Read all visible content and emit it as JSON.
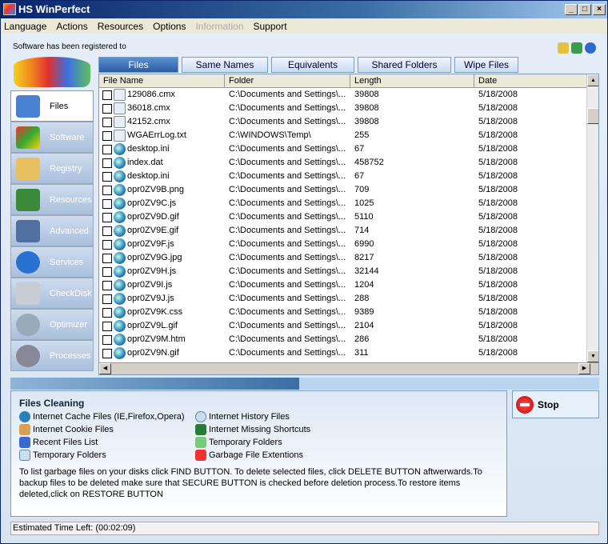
{
  "window": {
    "title": "HS WinPerfect"
  },
  "menu": [
    "Language",
    "Actions",
    "Resources",
    "Options",
    "Information",
    "Support"
  ],
  "registered": "Software has been registered to",
  "sidebar": [
    "Files",
    "Software",
    "Registry",
    "Resources",
    "Advanced",
    "Services",
    "CheckDisk",
    "Optimizer",
    "Processes"
  ],
  "tabs": [
    "Files",
    "Same Names",
    "Equivalents",
    "Shared Folders",
    "Wipe Files"
  ],
  "columns": [
    "File Name",
    "Folder",
    "Length",
    "Date"
  ],
  "rows": [
    [
      "129086.cmx",
      "C:\\Documents and Settings\\...",
      "39808",
      "5/18/2008",
      "doc"
    ],
    [
      "36018.cmx",
      "C:\\Documents and Settings\\...",
      "39808",
      "5/18/2008",
      "doc"
    ],
    [
      "42152.cmx",
      "C:\\Documents and Settings\\...",
      "39808",
      "5/18/2008",
      "doc"
    ],
    [
      "WGAErrLog.txt",
      "C:\\WINDOWS\\Temp\\",
      "255",
      "5/18/2008",
      "doc"
    ],
    [
      "desktop.ini",
      "C:\\Documents and Settings\\...",
      "67",
      "5/18/2008",
      "globe"
    ],
    [
      "index.dat",
      "C:\\Documents and Settings\\...",
      "458752",
      "5/18/2008",
      "globe"
    ],
    [
      "desktop.ini",
      "C:\\Documents and Settings\\...",
      "67",
      "5/18/2008",
      "globe"
    ],
    [
      "opr0ZV9B.png",
      "C:\\Documents and Settings\\...",
      "709",
      "5/18/2008",
      "globe"
    ],
    [
      "opr0ZV9C.js",
      "C:\\Documents and Settings\\...",
      "1025",
      "5/18/2008",
      "globe"
    ],
    [
      "opr0ZV9D.gif",
      "C:\\Documents and Settings\\...",
      "5110",
      "5/18/2008",
      "globe"
    ],
    [
      "opr0ZV9E.gif",
      "C:\\Documents and Settings\\...",
      "714",
      "5/18/2008",
      "globe"
    ],
    [
      "opr0ZV9F.js",
      "C:\\Documents and Settings\\...",
      "6990",
      "5/18/2008",
      "globe"
    ],
    [
      "opr0ZV9G.jpg",
      "C:\\Documents and Settings\\...",
      "8217",
      "5/18/2008",
      "globe"
    ],
    [
      "opr0ZV9H.js",
      "C:\\Documents and Settings\\...",
      "32144",
      "5/18/2008",
      "globe"
    ],
    [
      "opr0ZV9I.js",
      "C:\\Documents and Settings\\...",
      "1204",
      "5/18/2008",
      "globe"
    ],
    [
      "opr0ZV9J.js",
      "C:\\Documents and Settings\\...",
      "288",
      "5/18/2008",
      "globe"
    ],
    [
      "opr0ZV9K.css",
      "C:\\Documents and Settings\\...",
      "9389",
      "5/18/2008",
      "globe"
    ],
    [
      "opr0ZV9L.gif",
      "C:\\Documents and Settings\\...",
      "2104",
      "5/18/2008",
      "globe"
    ],
    [
      "opr0ZV9M.htm",
      "C:\\Documents and Settings\\...",
      "286",
      "5/18/2008",
      "globe"
    ],
    [
      "opr0ZV9N.gif",
      "C:\\Documents and Settings\\...",
      "311",
      "5/18/2008",
      "globe"
    ]
  ],
  "progress_percent": 49,
  "panel": {
    "title": "Files Cleaning",
    "items": [
      "Internet Cache Files (IE,Firefox,Opera)",
      "Internet History Files",
      "Internet Cookie Files",
      "Internet Missing Shortcuts",
      "Recent Files List",
      "Temporary Folders",
      "Temporary Folders",
      "Garbage File Extentions"
    ],
    "description": "To list garbage files on your disks click FIND BUTTON. To delete selected files, click DELETE BUTTON aftwerwards.To backup files to be deleted make sure that SECURE BUTTON is checked before deletion process.To restore items deleted,click on RESTORE BUTTON"
  },
  "stop_label": "Stop",
  "status": "Estimated Time Left: (00:02:09)"
}
